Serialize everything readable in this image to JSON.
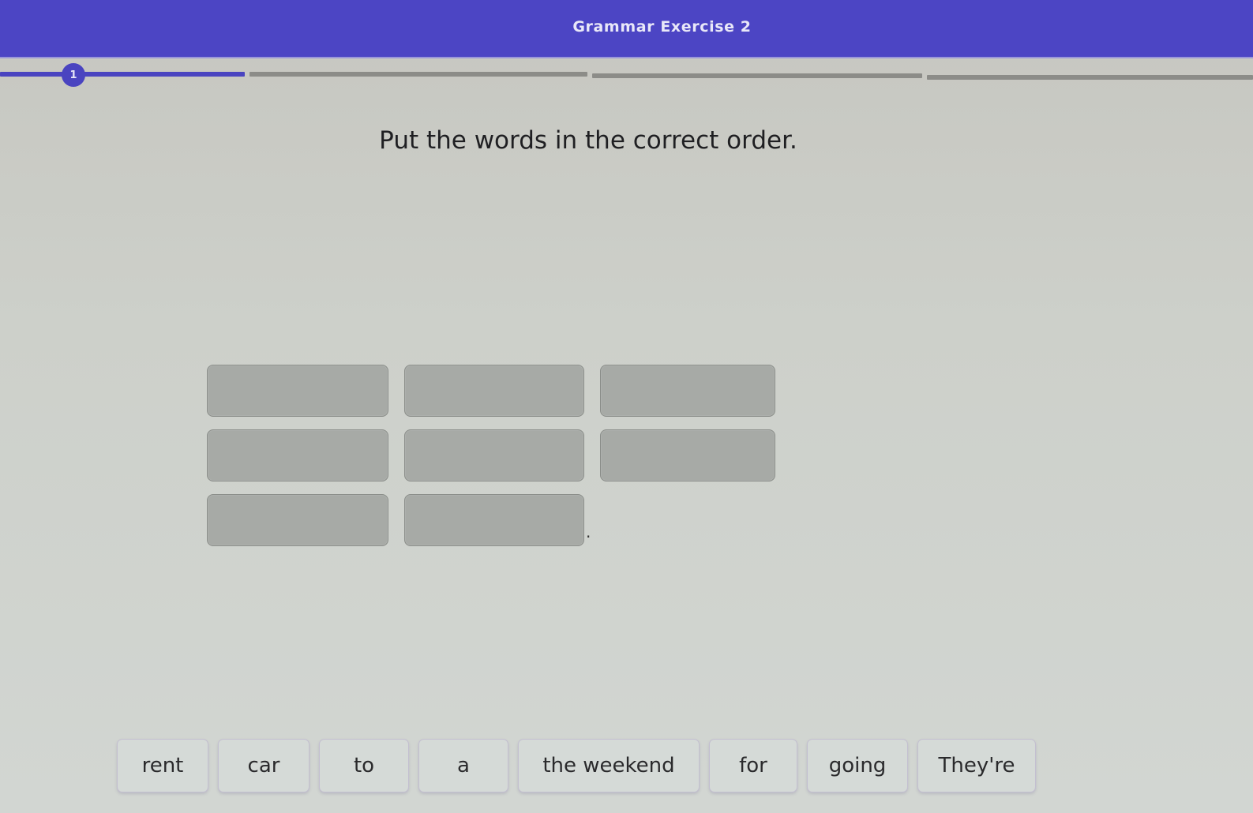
{
  "header": {
    "title": "Grammar Exercise 2"
  },
  "progress": {
    "current_step": "1",
    "total_segments": 4,
    "completed_segments": 1,
    "accent_color": "#4a44c0"
  },
  "question": {
    "instruction": "Put the words in the correct order.",
    "blank_count": 8,
    "sentence_end": "."
  },
  "word_bank": [
    {
      "label": "rent"
    },
    {
      "label": "car"
    },
    {
      "label": "to"
    },
    {
      "label": "a"
    },
    {
      "label": "the weekend"
    },
    {
      "label": "for"
    },
    {
      "label": "going"
    },
    {
      "label": "They're"
    }
  ]
}
